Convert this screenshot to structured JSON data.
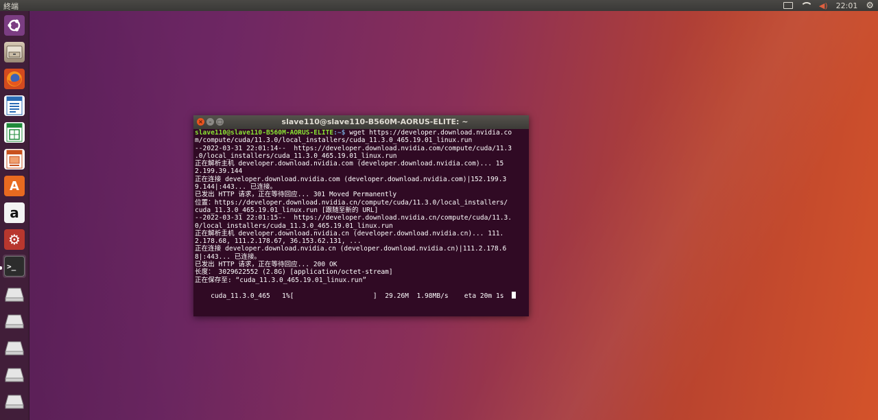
{
  "top_panel": {
    "app_title": "終端",
    "clock": "22:01",
    "indicators": [
      "keyboard-icon",
      "wifi-icon",
      "volume-muted-icon",
      "gear-icon"
    ]
  },
  "launcher": {
    "items": [
      {
        "name": "ubuntu-dash",
        "icon": "ubuntu-logo-icon"
      },
      {
        "name": "files",
        "icon": "file-cabinet-icon"
      },
      {
        "name": "firefox",
        "icon": "firefox-icon"
      },
      {
        "name": "libreoffice-writer",
        "icon": "writer-document-icon"
      },
      {
        "name": "libreoffice-calc",
        "icon": "calc-spreadsheet-icon"
      },
      {
        "name": "libreoffice-impress",
        "icon": "impress-presentation-icon"
      },
      {
        "name": "ubuntu-software",
        "icon": "software-center-icon"
      },
      {
        "name": "amazon",
        "icon": "amazon-icon"
      },
      {
        "name": "system-settings",
        "icon": "settings-tools-icon"
      },
      {
        "name": "terminal",
        "icon": "terminal-icon",
        "active": true
      },
      {
        "name": "drive-1",
        "icon": "drive-icon"
      },
      {
        "name": "drive-2",
        "icon": "drive-icon"
      },
      {
        "name": "drive-3",
        "icon": "drive-icon"
      },
      {
        "name": "drive-4",
        "icon": "drive-icon"
      },
      {
        "name": "drive-5",
        "icon": "drive-icon"
      }
    ]
  },
  "terminal": {
    "title": "slave110@slave110-B560M-AORUS-ELITE: ~",
    "prompt_user": "slave110@slave110-B560M-AORUS-ELITE",
    "prompt_path": ":~$",
    "command": " wget https://developer.download.nvidia.co",
    "lines": [
      "m/compute/cuda/11.3.0/local_installers/cuda_11.3.0_465.19.01_linux.run",
      "--2022-03-31 22:01:14--  https://developer.download.nvidia.com/compute/cuda/11.3",
      ".0/local_installers/cuda_11.3.0_465.19.01_linux.run",
      "正在解析主机 developer.download.nvidia.com (developer.download.nvidia.com)... 15",
      "2.199.39.144",
      "正在连接 developer.download.nvidia.com (developer.download.nvidia.com)|152.199.3",
      "9.144|:443... 已连接。",
      "已发出 HTTP 请求，正在等待回应... 301 Moved Permanently",
      "位置：https://developer.download.nvidia.cn/compute/cuda/11.3.0/local_installers/",
      "cuda_11.3.0_465.19.01_linux.run [跟随至新的 URL]",
      "--2022-03-31 22:01:15--  https://developer.download.nvidia.cn/compute/cuda/11.3.",
      "0/local_installers/cuda_11.3.0_465.19.01_linux.run",
      "正在解析主机 developer.download.nvidia.cn (developer.download.nvidia.cn)... 111.",
      "2.178.68, 111.2.178.67, 36.153.62.131, ...",
      "正在连接 developer.download.nvidia.cn (developer.download.nvidia.cn)|111.2.178.6",
      "8|:443... 已连接。",
      "已发出 HTTP 请求，正在等待回应... 200 OK",
      "长度： 3029622552 (2.8G) [application/octet-stream]",
      "正在保存至: “cuda_11.3.0_465.19.01_linux.run”",
      ""
    ],
    "progress_line": "    cuda_11.3.0_465   1%[                    ]  29.26M  1.98MB/s    eta 20m 1s  ",
    "progress_fraction": 0.01
  }
}
